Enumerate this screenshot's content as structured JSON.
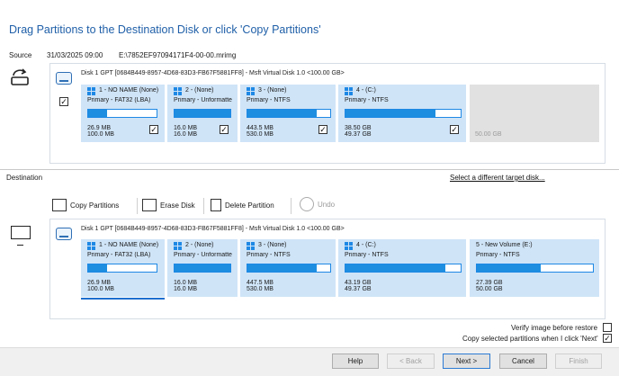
{
  "title": "Drag Partitions to the Destination Disk or click 'Copy Partitions'",
  "source": {
    "label": "Source",
    "date": "31/03/2025 09:00",
    "path": "E:\\7852EF97094171F4-00-00.mrimg",
    "disk_header": "Disk 1 GPT [0684B449-8957-4D68-83D3-FB67F5881FF8] - Msft     Virtual Disk     1.0  <100.00 GB>",
    "disk_checked": "✓",
    "partitions": [
      {
        "name": "1 - NO NAME (None)",
        "type": "Primary - FAT32 (LBA)",
        "used": "26.9 MB",
        "total": "100.0 MB",
        "fill": 0.27,
        "checked": "✓"
      },
      {
        "name": "2 -  (None)",
        "type": "Primary - Unformatte",
        "used": "16.0 MB",
        "total": "16.0 MB",
        "fill": 1.0,
        "checked": "✓"
      },
      {
        "name": "3 -  (None)",
        "type": "Primary - NTFS",
        "used": "443.5 MB",
        "total": "530.0 MB",
        "fill": 0.84,
        "checked": "✓"
      },
      {
        "name": "4 -  (C:)",
        "type": "Primary - NTFS",
        "used": "38.50 GB",
        "total": "49.37 GB",
        "fill": 0.78,
        "checked": "✓"
      }
    ],
    "unallocated": "50.00 GB"
  },
  "destination": {
    "label": "Destination",
    "select_link": "Select a different target disk...",
    "toolbar": {
      "copy": "Copy Partitions",
      "erase": "Erase Disk",
      "delete": "Delete Partition",
      "undo": "Undo"
    },
    "disk_header": "Disk 1 GPT [0684B449-8957-4D68-83D3-FB67F5881FF8] - Msft     Virtual Disk     1.0  <100.00 GB>",
    "partitions": [
      {
        "name": "1 - NO NAME (None)",
        "type": "Primary - FAT32 (LBA)",
        "used": "26.9 MB",
        "total": "100.0 MB",
        "fill": 0.27
      },
      {
        "name": "2 -  (None)",
        "type": "Primary - Unformatte",
        "used": "16.0 MB",
        "total": "16.0 MB",
        "fill": 1.0
      },
      {
        "name": "3 -  (None)",
        "type": "Primary - NTFS",
        "used": "447.5 MB",
        "total": "530.0 MB",
        "fill": 0.84
      },
      {
        "name": "4 -  (C:)",
        "type": "Primary - NTFS",
        "used": "43.19 GB",
        "total": "49.37 GB",
        "fill": 0.87
      },
      {
        "name": "5 - New Volume (E:)",
        "type": "Primary - NTFS",
        "used": "27.39 GB",
        "total": "50.00 GB",
        "fill": 0.55
      }
    ]
  },
  "options": {
    "verify": "Verify image before restore",
    "verify_checked": "",
    "copy_next": "Copy selected partitions when I click 'Next'",
    "copy_next_checked": "✓"
  },
  "buttons": {
    "help": "Help",
    "back": "< Back",
    "next": "Next >",
    "cancel": "Cancel",
    "finish": "Finish"
  }
}
